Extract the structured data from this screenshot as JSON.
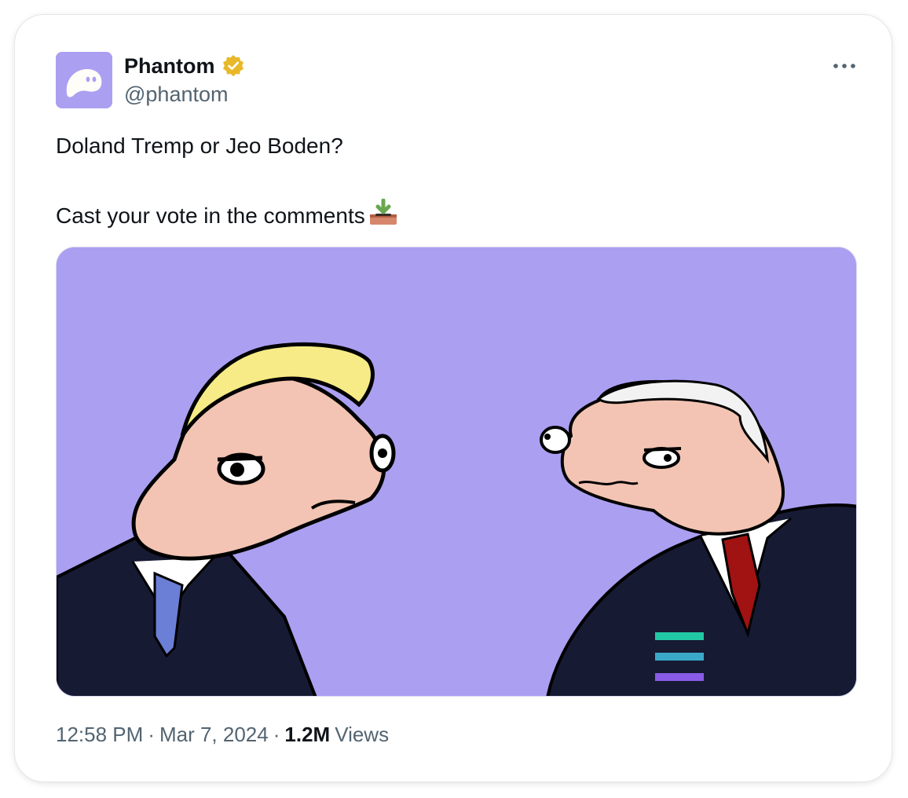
{
  "tweet": {
    "display_name": "Phantom",
    "handle": "@phantom",
    "text_line1": "Doland Tremp or Jeo Boden?",
    "text_line2": "Cast your vote in the comments",
    "emoji": "ballot-box-icon",
    "time": "12:58 PM",
    "date": "Mar 7, 2024",
    "separator": "·",
    "views_count": "1.2M",
    "views_label": "Views"
  },
  "icons": {
    "verified": "verified-badge-icon",
    "more": "more-options-icon"
  },
  "colors": {
    "avatar_bg": "#ab9ff2",
    "verified_gold": "#e8b829",
    "secondary_text": "#536471",
    "primary_text": "#0f1419",
    "media_bg": "#ab9ff2"
  }
}
